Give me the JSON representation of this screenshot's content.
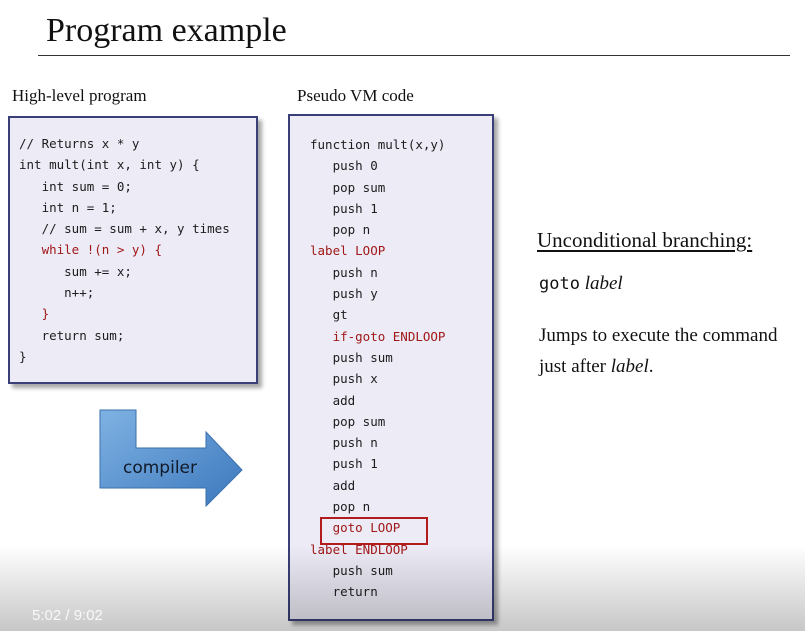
{
  "slide": {
    "title": "Program example",
    "left_label": "High-level program",
    "right_label": "Pseudo VM code",
    "arrow_label": "compiler",
    "side_title": "Unconditional branching:",
    "goto_keyword": "goto",
    "goto_arg": "label",
    "desc_part1": "Jumps to execute the command just after ",
    "desc_italic": "label",
    "desc_part3": "."
  },
  "high_level_code": [
    {
      "text": "// Returns x * y",
      "red": false
    },
    {
      "text": "int mult(int x, int y) {",
      "red": false
    },
    {
      "text": "   int sum = 0;",
      "red": false
    },
    {
      "text": "   int n = 1;",
      "red": false
    },
    {
      "text": "   // sum = sum + x, y times",
      "red": false
    },
    {
      "text": "   while !(n > y) {",
      "red": true
    },
    {
      "text": "      sum += x;",
      "red": false
    },
    {
      "text": "      n++;",
      "red": false
    },
    {
      "text": "   }",
      "red": true
    },
    {
      "text": "   return sum;",
      "red": false
    },
    {
      "text": "}",
      "red": false
    }
  ],
  "vm_code": [
    {
      "text": "function mult(x,y)",
      "red": false
    },
    {
      "text": "   push 0",
      "red": false
    },
    {
      "text": "   pop sum",
      "red": false
    },
    {
      "text": "   push 1",
      "red": false
    },
    {
      "text": "   pop n",
      "red": false
    },
    {
      "text": "label LOOP",
      "red": true
    },
    {
      "text": "   push n",
      "red": false
    },
    {
      "text": "   push y",
      "red": false
    },
    {
      "text": "   gt",
      "red": false
    },
    {
      "text": "   if-goto ENDLOOP",
      "red": true
    },
    {
      "text": "   push sum",
      "red": false
    },
    {
      "text": "   push x",
      "red": false
    },
    {
      "text": "   add",
      "red": false
    },
    {
      "text": "   pop sum",
      "red": false
    },
    {
      "text": "   push n",
      "red": false
    },
    {
      "text": "   push 1",
      "red": false
    },
    {
      "text": "   add",
      "red": false
    },
    {
      "text": "   pop n",
      "red": false
    },
    {
      "text": "   goto LOOP",
      "red": true
    },
    {
      "text": "label ENDLOOP",
      "red": true
    },
    {
      "text": "   push sum",
      "red": false
    },
    {
      "text": "   return",
      "red": false
    }
  ],
  "player": {
    "time": "5:02  /  9:02"
  },
  "colors": {
    "box_bg": "#ecebf6",
    "box_border": "#3a3f78",
    "highlight_red": "#a01818",
    "arrow_blue": "#4a86c8"
  }
}
